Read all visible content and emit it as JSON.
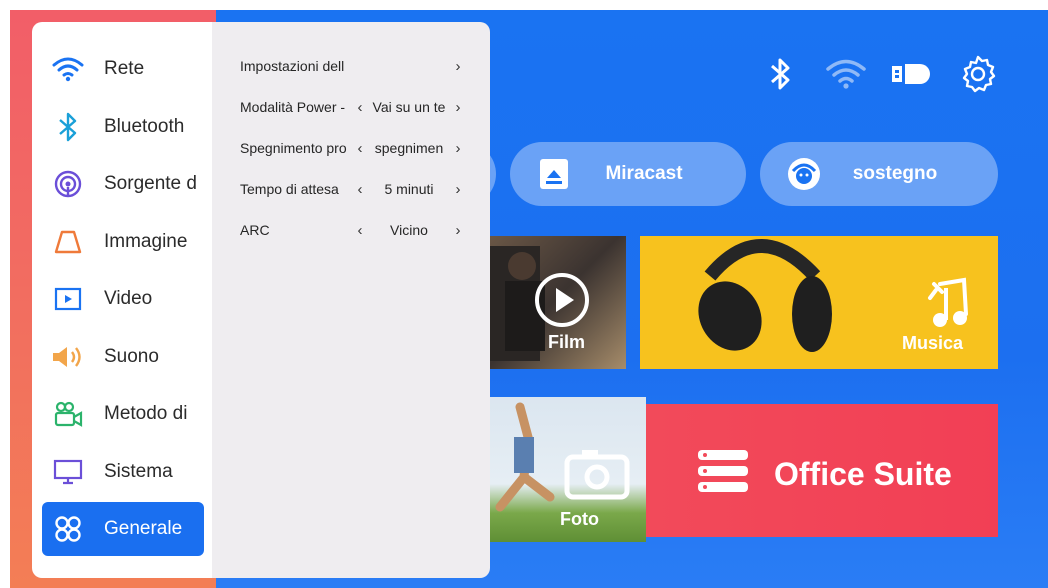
{
  "top_icons": [
    "bluetooth-icon",
    "wifi-icon",
    "projector-icon",
    "gear-icon"
  ],
  "quick": {
    "miracast_label": "Miracast",
    "support_label": "sostegno"
  },
  "tiles": {
    "film_label": "Film",
    "music_label": "Musica",
    "foto_label": "Foto",
    "office_label": "Office Suite"
  },
  "menu": {
    "items": [
      {
        "label": "Rete",
        "icon": "wifi-icon"
      },
      {
        "label": "Bluetooth",
        "icon": "bluetooth-icon"
      },
      {
        "label": "Sorgente d",
        "icon": "source-icon"
      },
      {
        "label": "Immagine",
        "icon": "trapezoid-icon"
      },
      {
        "label": "Video",
        "icon": "video-icon"
      },
      {
        "label": "Suono",
        "icon": "speaker-icon"
      },
      {
        "label": "Metodo di",
        "icon": "camera-icon"
      },
      {
        "label": "Sistema",
        "icon": "monitor-icon"
      },
      {
        "label": "Generale",
        "icon": "general-icon"
      }
    ],
    "active_index": 8
  },
  "submenu": {
    "rows": [
      {
        "label": "Impostazioni dell",
        "value": ""
      },
      {
        "label": "Modalità Power -",
        "value": "Vai su un te"
      },
      {
        "label": "Spegnimento pro",
        "value": "spegnimen"
      },
      {
        "label": "Tempo di attesa",
        "value": "5 minuti"
      },
      {
        "label": "ARC",
        "value": "Vicino"
      }
    ],
    "left_arrow": "‹",
    "right_arrow": "›"
  },
  "colors": {
    "accent_blue": "#1a6ff0",
    "background_blue": "#1a73f2",
    "red_strip": "#f25e68",
    "music_yellow": "#f7c21e",
    "office_red": "#f24a5a"
  }
}
